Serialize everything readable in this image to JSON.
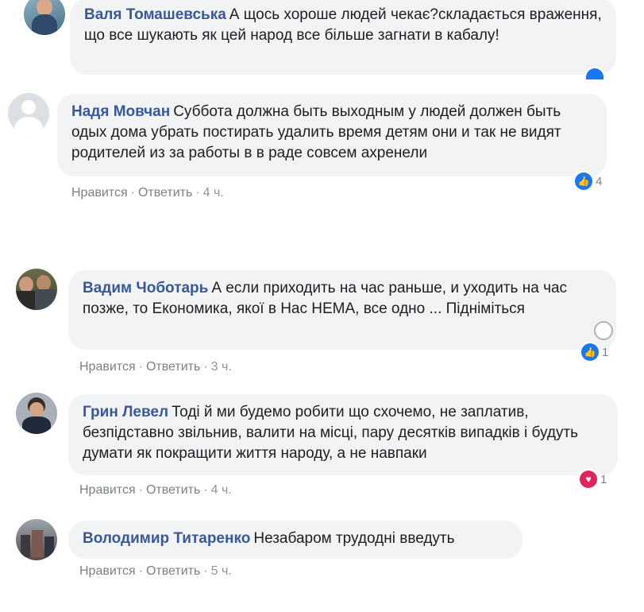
{
  "comments": [
    {
      "author": "Валя Томашевська",
      "text": "А щось хороше людей чекає?складається враження, що все шукають як цей народ все більше загнати в кабалу!"
    },
    {
      "author": "Надя Мовчан",
      "text": "Суббота должна быть выходным у людей должен быть одых дома убрать постирать удалить время детям они и так не видят родителей из за работы в в раде совсем ахренели",
      "like": "Нравится",
      "reply": "Ответить",
      "time": "4 ч.",
      "reaction_count": "4",
      "reaction_type": "like-icon"
    },
    {
      "author": "Вадим Чоботарь",
      "text": "А если приходить на час раньше, и уходить на час позже, то Економика, якої в Нас НЕМА, все одно ... Підніміться",
      "like": "Нравится",
      "reply": "Ответить",
      "time": "3 ч.",
      "reaction_count": "1",
      "reaction_type": "like-icon"
    },
    {
      "author": "Грин Левел",
      "text": "Тоді й ми будемо робити що схочемо, не заплатив, безпідставно звільнив, валити на місці, пару десятків випадків і будуть думати як покращити життя народу, а не навпаки",
      "like": "Нравится",
      "reply": "Ответить",
      "time": "4 ч.",
      "reaction_count": "1",
      "reaction_type": "heart-icon"
    },
    {
      "author": "Володимир Титаренко",
      "text": "Незабаром трудодні введуть",
      "like": "Нравится",
      "reply": "Ответить",
      "time": "5 ч."
    }
  ],
  "colors": {
    "author": "#385898",
    "bubble": "#f2f3f5",
    "like": "#1877f2",
    "love": "#e0245e"
  }
}
